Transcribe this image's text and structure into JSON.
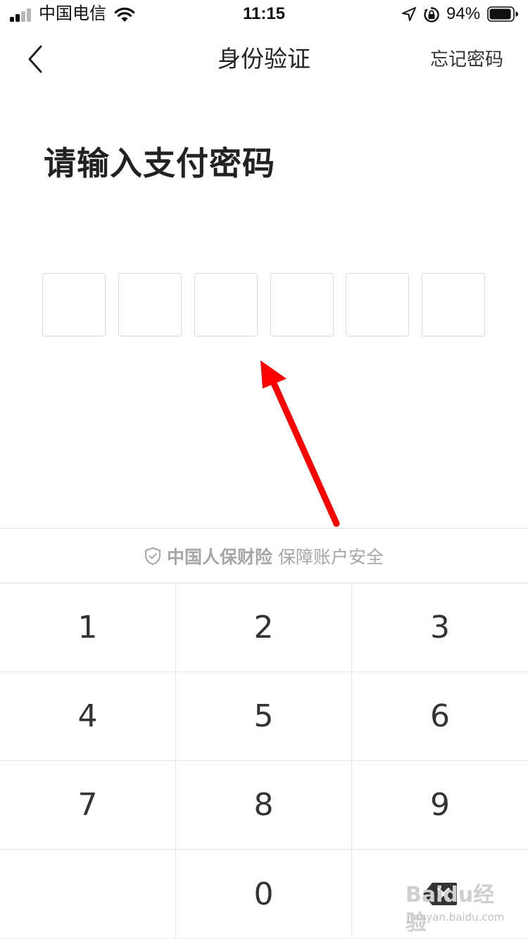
{
  "status_bar": {
    "carrier": "中国电信",
    "time": "11:15",
    "battery_percent": "94%",
    "battery_level": 0.94,
    "signal_bars_active": 2,
    "icons": [
      "signal-icon",
      "wifi-icon",
      "location-arrow-icon",
      "orientation-lock-icon",
      "battery-icon"
    ]
  },
  "nav": {
    "back_icon": "chevron-left-icon",
    "title": "身份验证",
    "forgot_label": "忘记密码"
  },
  "prompt": "请输入支付密码",
  "pin": {
    "length": 6,
    "digits": [
      "",
      "",
      "",
      "",
      "",
      ""
    ]
  },
  "annotation": {
    "type": "arrow",
    "color": "#ff0000"
  },
  "security": {
    "icon": "shield-check-icon",
    "brand": "中国人保财险",
    "slogan": "保障账户安全"
  },
  "keypad": {
    "keys": [
      "1",
      "2",
      "3",
      "4",
      "5",
      "6",
      "7",
      "8",
      "9",
      "",
      "0",
      "⌫"
    ],
    "backspace_icon": "backspace-icon"
  },
  "watermark": {
    "text": "Baidu经验",
    "sub": "jingyan.baidu.com"
  },
  "colors": {
    "background": "#ffffff",
    "text_primary": "#222222",
    "text_muted": "#a6a6a6",
    "divider": "#e6e6e6",
    "pin_border": "#dcdcdc",
    "annotation": "#ff0000"
  }
}
